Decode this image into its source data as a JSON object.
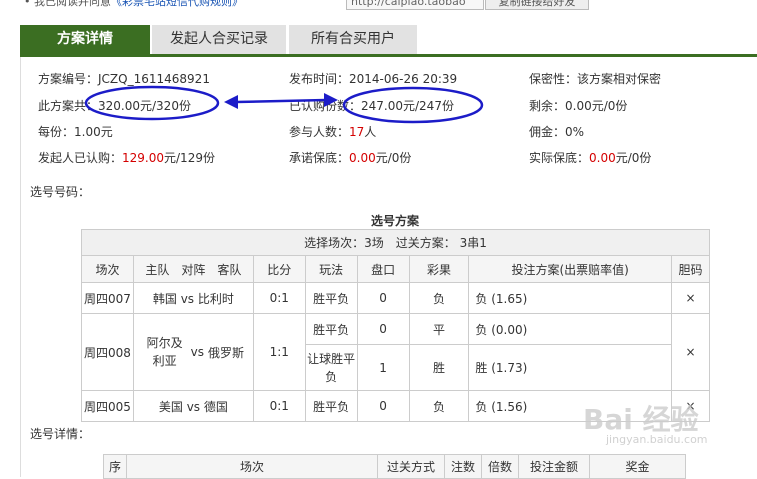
{
  "top": {
    "prefix": "• 我已阅读并同意",
    "link": "《彩票宅站短信代购规则》",
    "url": "http://caipiao.taobao",
    "copy_button": "复制链接给好友"
  },
  "tabs": [
    "方案详情",
    "发起人合买记录",
    "所有合买用户"
  ],
  "info": {
    "plan_no": {
      "label": "方案编号：",
      "value": "JCZQ_1611468921"
    },
    "publish_time": {
      "label": "发布时间：",
      "value": "2014-06-26 20:39"
    },
    "privacy": {
      "label": "保密性：",
      "value": "该方案相对保密"
    },
    "plan_total": {
      "label": "此方案共：",
      "value": "320.00元/320份"
    },
    "sold": {
      "label": "已认购份数：",
      "value": "247.00元/247份"
    },
    "remaining": {
      "label": "剩余：",
      "value": "0.00元/0份"
    },
    "per_share": {
      "label": "每份：",
      "value": "1.00元"
    },
    "participants": {
      "label": "参与人数：",
      "value": "17",
      "unit": "人"
    },
    "commission": {
      "label": "佣金：",
      "value": "0%"
    },
    "initiator": {
      "label": "发起人已认购：",
      "value": "129.00",
      "unit": "元/129份"
    },
    "promised_guarantee": {
      "label": "承诺保底：",
      "value": "0.00",
      "unit": "元/0份"
    },
    "actual_guarantee": {
      "label": "实际保底：",
      "value": "0.00",
      "unit": "元/0份"
    }
  },
  "selection_label": "选号号码：",
  "selection_plan": {
    "caption": "选号方案",
    "summary": "选择场次：3场　过关方案：  3串1",
    "headers": [
      "场次",
      "主队　对阵　客队",
      "比分",
      "玩法",
      "盘口",
      "彩果",
      "投注方案(出票赔率值)",
      "胆码"
    ],
    "rows": [
      {
        "match": "周四007",
        "home": "韩国",
        "vs": "vs",
        "away": "比利时",
        "score": "0:1",
        "play": "胜平负",
        "handicap": "0",
        "result": "负",
        "bet": "负 (1.65)",
        "banker": "×"
      },
      {
        "match": "周四008",
        "home": "阿尔及利亚",
        "vs": "vs",
        "away": "俄罗斯",
        "score": "1:1",
        "play": "胜平负",
        "handicap": "0",
        "result": "平",
        "bet": "负 (0.00)",
        "banker": "×",
        "play2": "让球胜平负",
        "handicap2": "1",
        "result2": "胜",
        "bet2": "胜 (1.73)"
      },
      {
        "match": "周四005",
        "home": "美国",
        "vs": "vs",
        "away": "德国",
        "score": "0:1",
        "play": "胜平负",
        "handicap": "0",
        "result": "负",
        "bet": "负 (1.56)",
        "banker": "×"
      }
    ]
  },
  "details_label": "选号详情：",
  "details_headers": [
    "序",
    "场次",
    "过关方式",
    "注数",
    "倍数",
    "投注金额",
    "奖金"
  ],
  "watermark": {
    "main": "Bai 经验",
    "sub": "jingyan.baidu.com"
  },
  "colors": {
    "tab_active": "#3b6e22",
    "red": "#d40000",
    "annotation": "#1c1cc8"
  }
}
